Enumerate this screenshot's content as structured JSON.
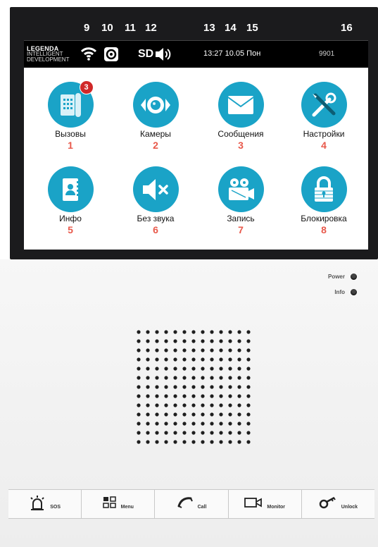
{
  "callout_numbers": {
    "wifi": "9",
    "camera_status": "10",
    "sd": "11",
    "volume": "12",
    "time": "13",
    "date": "14",
    "weekday": "15",
    "extension": "16"
  },
  "statusbar": {
    "logo_line1": "LEGENDA",
    "logo_line2": "INTELLIGENT",
    "logo_line3": "DEVELOPMENT",
    "sd_label": "SD",
    "clock": "13:27 10.05 Пон",
    "extension": "9901"
  },
  "tiles": [
    {
      "label": "Вызовы",
      "num": "1",
      "icon": "phone-icon",
      "badge": "3"
    },
    {
      "label": "Камеры",
      "num": "2",
      "icon": "camera-eye-icon"
    },
    {
      "label": "Сообщения",
      "num": "3",
      "icon": "envelope-icon"
    },
    {
      "label": "Настройки",
      "num": "4",
      "icon": "tools-icon"
    },
    {
      "label": "Инфо",
      "num": "5",
      "icon": "contact-book-icon"
    },
    {
      "label": "Без звука",
      "num": "6",
      "icon": "mute-icon"
    },
    {
      "label": "Запись",
      "num": "7",
      "icon": "video-camera-icon"
    },
    {
      "label": "Блокировка",
      "num": "8",
      "icon": "lock-icon"
    }
  ],
  "indicators": {
    "power": "Power",
    "info": "Info"
  },
  "hardware_buttons": {
    "sos": "SOS",
    "menu": "Menu",
    "call": "Call",
    "monitor": "Monitor",
    "unlock": "Unlock"
  },
  "colors": {
    "accent": "#1aa3c7",
    "callout": "#e8584a",
    "badge": "#d02828"
  }
}
